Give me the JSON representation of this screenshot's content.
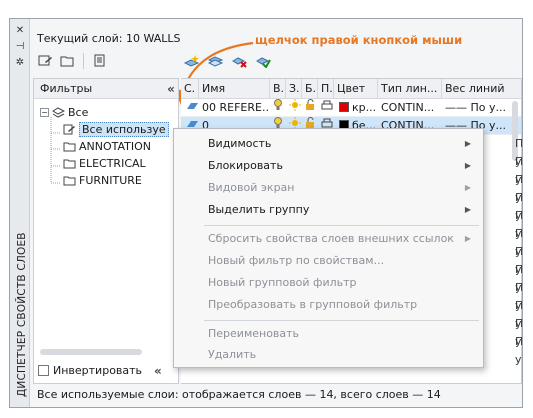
{
  "palette": {
    "title": "ДИСПЕТЧЕР СВОЙСТВ СЛОЕВ",
    "strip_buttons": [
      "close",
      "pin",
      "properties"
    ]
  },
  "current_layer": "Текущий слой: 10 WALLS",
  "callout": "щелчок правой кнопкой мыши",
  "filters": {
    "header": "Фильтры",
    "root": "Все",
    "nodes": [
      "Все используе",
      "ANNOTATION",
      "ELECTRICAL",
      "FURNITURE"
    ],
    "invert_label": "Инвертировать"
  },
  "grid": {
    "columns": [
      "С.",
      "Имя",
      "В.",
      "З.",
      "Б.",
      "П.",
      "Цвет",
      "Тип лин...",
      "Вес линий"
    ],
    "rows": [
      {
        "name": "00 REFERE...",
        "color_hex": "#e00000",
        "color_name": "кр...",
        "linetype": "CONTIN...",
        "lineweight": "—— По у..."
      },
      {
        "name": "0",
        "color_hex": "#000000",
        "color_name": "бе...",
        "linetype": "CONTIN...",
        "lineweight": "—— По у..."
      }
    ],
    "extra_rows_text": "По у..."
  },
  "context_menu": {
    "items": [
      {
        "label": "Видимость",
        "submenu": true,
        "disabled": false
      },
      {
        "label": "Блокировать",
        "submenu": true,
        "disabled": false
      },
      {
        "label": "Видовой экран",
        "submenu": true,
        "disabled": true
      },
      {
        "label": "Выделить группу",
        "submenu": true,
        "disabled": false
      },
      {
        "label": "Сбросить свойства слоев внешних ссылок",
        "submenu": true,
        "disabled": true
      },
      {
        "label": "Новый фильтр по свойствам...",
        "submenu": false,
        "disabled": true
      },
      {
        "label": "Новый групповой фильтр",
        "submenu": false,
        "disabled": true
      },
      {
        "label": "Преобразовать в групповой фильтр",
        "submenu": false,
        "disabled": true
      },
      {
        "label": "Переименовать",
        "submenu": false,
        "disabled": true
      },
      {
        "label": "Удалить",
        "submenu": false,
        "disabled": true
      }
    ]
  },
  "status": "Все используемые слои: отображается слоев — 14, всего слоев — 14",
  "accent_colors": {
    "callout": "#e87722",
    "selection": "#cfe5f9"
  }
}
